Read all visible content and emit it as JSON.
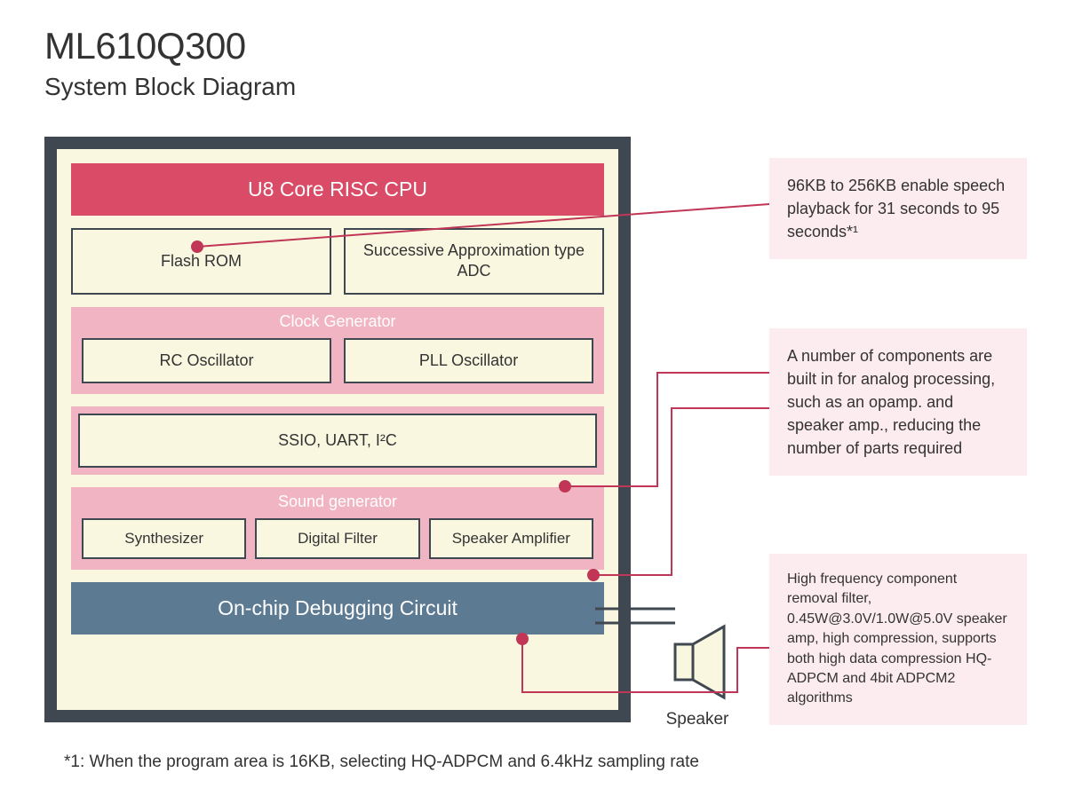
{
  "header": {
    "title": "ML610Q300",
    "subtitle": "System Block Diagram"
  },
  "chip": {
    "cpu": "U8 Core RISC CPU",
    "flash_rom": "Flash ROM",
    "adc": "Successive Approximation type ADC",
    "clock_generator": {
      "title": "Clock Generator",
      "rc_osc": "RC Oscillator",
      "pll_osc": "PLL Oscillator"
    },
    "comm": "SSIO, UART, I²C",
    "sound_generator": {
      "title": "Sound generator",
      "synth": "Synthesizer",
      "filter": "Digital Filter",
      "spk_amp": "Speaker Amplifier"
    },
    "debug": "On-chip Debugging Circuit"
  },
  "speaker_label": "Speaker",
  "callouts": {
    "rom": "96KB to 256KB enable speech playback for 31 seconds to 95 seconds*¹",
    "analog": "A number of components are built in for analog processing, such as an opamp. and speaker amp., reducing the number of parts required",
    "sound": "High frequency component removal filter, 0.45W@3.0V/1.0W@5.0V speaker amp, high compression, supports both high data compression HQ-ADPCM and 4bit ADPCM2 algorithms"
  },
  "footnote": "*1: When the program area is 16KB, selecting HQ-ADPCM and 6.4kHz sampling rate"
}
